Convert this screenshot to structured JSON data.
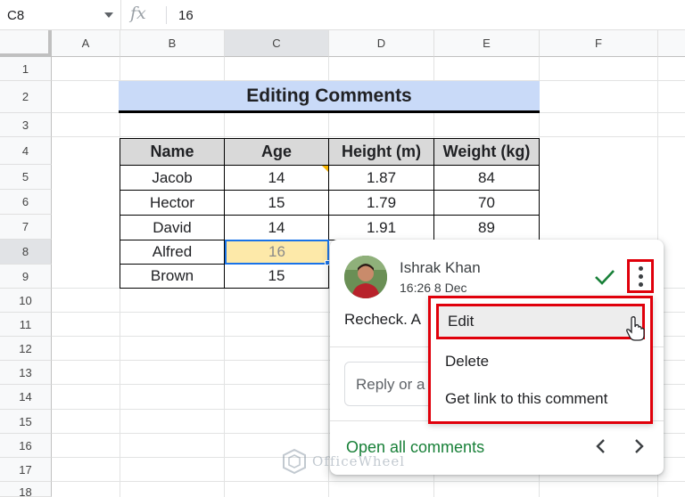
{
  "formula_bar": {
    "name_box": "C8",
    "fx_label": "fx",
    "value": "16"
  },
  "columns": [
    "A",
    "B",
    "C",
    "D",
    "E",
    "F"
  ],
  "rows": [
    "1",
    "2",
    "3",
    "4",
    "5",
    "6",
    "7",
    "8",
    "9",
    "10",
    "11",
    "12",
    "13",
    "14",
    "15",
    "16",
    "17",
    "18"
  ],
  "sheet": {
    "title": "Editing Comments",
    "headers": [
      "Name",
      "Age",
      "Height (m)",
      "Weight (kg)"
    ],
    "rows": [
      [
        "Jacob",
        "14",
        "1.87",
        "84"
      ],
      [
        "Hector",
        "15",
        "1.79",
        "70"
      ],
      [
        "David",
        "14",
        "1.91",
        "89"
      ],
      [
        "Alfred",
        "16"
      ],
      [
        "Brown",
        "15"
      ]
    ],
    "selected_cell": "C8"
  },
  "comment": {
    "author": "Ishrak Khan",
    "time": "16:26 8 Dec",
    "text": "Recheck. A",
    "reply_placeholder": "Reply or a",
    "open_all": "Open all comments",
    "menu": [
      "Edit",
      "Delete",
      "Get link to this comment"
    ]
  },
  "watermark": "OfficeWheel",
  "colors": {
    "title_fill": "#c9daf8",
    "header_fill": "#d9d9d9",
    "selected_fill": "#fde9a9",
    "selection_border": "#1a73e8",
    "highlight_red": "#e0000b",
    "link_green": "#188038"
  }
}
